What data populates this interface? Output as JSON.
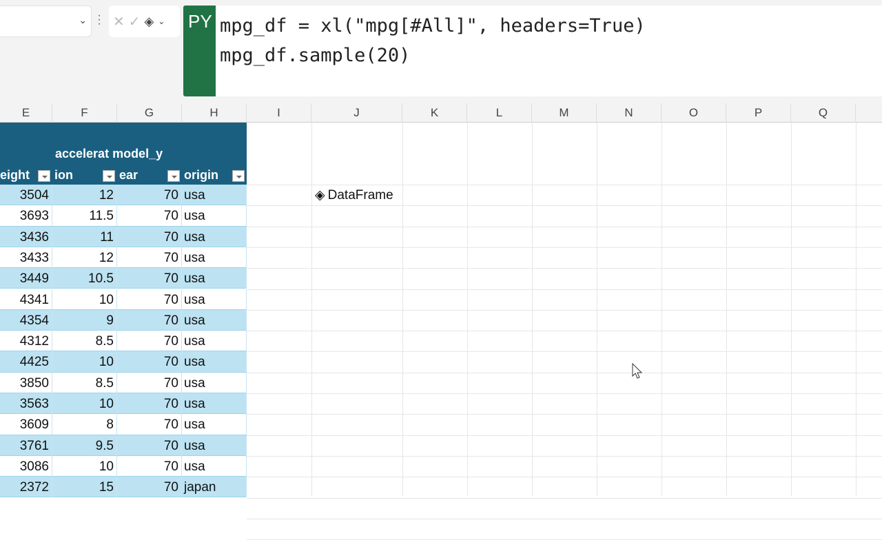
{
  "formula_bar": {
    "mode_badge": "PY",
    "lines": [
      "mpg_df = xl(\"mpg[#All]\", headers=True)",
      "",
      "mpg_df.sample(20)"
    ]
  },
  "columns": [
    "E",
    "F",
    "G",
    "H",
    "I",
    "J",
    "K",
    "L",
    "M",
    "N",
    "O",
    "P",
    "Q"
  ],
  "table": {
    "header_top": "accelerat model_y",
    "headers": [
      "eight",
      "ion",
      "ear",
      "origin"
    ],
    "rows": [
      [
        "3504",
        "12",
        "70",
        "usa"
      ],
      [
        "3693",
        "11.5",
        "70",
        "usa"
      ],
      [
        "3436",
        "11",
        "70",
        "usa"
      ],
      [
        "3433",
        "12",
        "70",
        "usa"
      ],
      [
        "3449",
        "10.5",
        "70",
        "usa"
      ],
      [
        "4341",
        "10",
        "70",
        "usa"
      ],
      [
        "4354",
        "9",
        "70",
        "usa"
      ],
      [
        "4312",
        "8.5",
        "70",
        "usa"
      ],
      [
        "4425",
        "10",
        "70",
        "usa"
      ],
      [
        "3850",
        "8.5",
        "70",
        "usa"
      ],
      [
        "3563",
        "10",
        "70",
        "usa"
      ],
      [
        "3609",
        "8",
        "70",
        "usa"
      ],
      [
        "3761",
        "9.5",
        "70",
        "usa"
      ],
      [
        "3086",
        "10",
        "70",
        "usa"
      ],
      [
        "2372",
        "15",
        "70",
        "japan"
      ]
    ]
  },
  "dataframe_cell": {
    "label": "DataFrame"
  },
  "colors": {
    "header": "#1a5f80",
    "band": "#bde3f3",
    "python": "#217346"
  }
}
